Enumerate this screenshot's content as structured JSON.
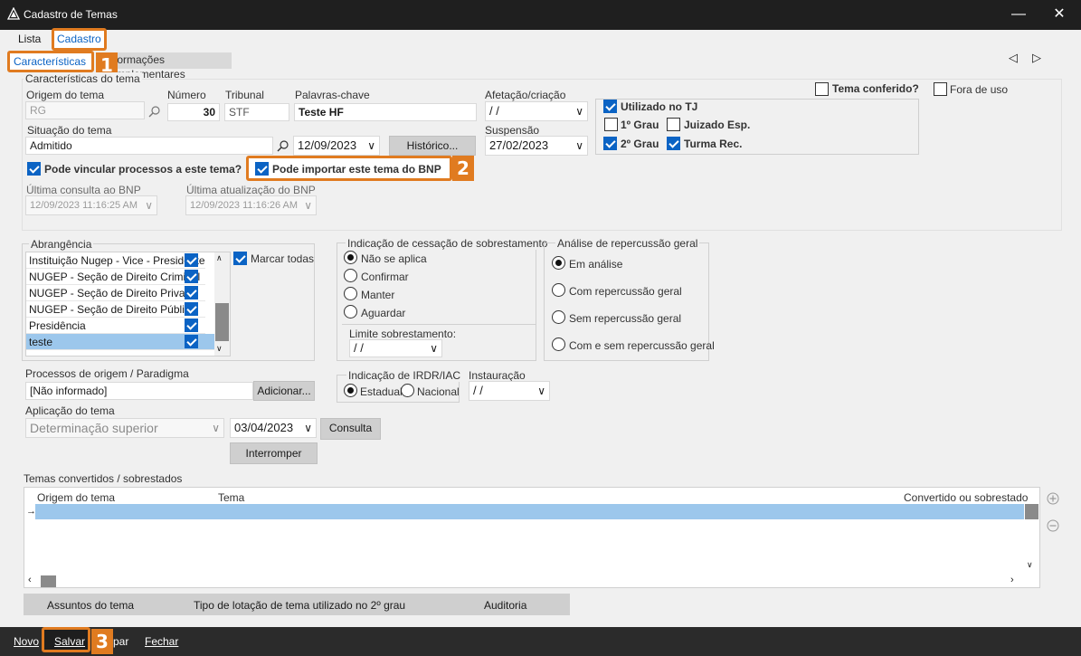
{
  "window": {
    "title": "Cadastro de Temas"
  },
  "tabs": {
    "lista": "Lista",
    "cadastro": "Cadastro"
  },
  "subtabs": {
    "caracteristicas": "Características",
    "informacoes": "Informações complementares"
  },
  "badges": {
    "b1": "1",
    "b2": "2",
    "b3": "3"
  },
  "nav": {
    "prev": "◁",
    "next": "▷"
  },
  "section": {
    "title": "Características do tema"
  },
  "fields": {
    "origem_label": "Origem do tema",
    "origem_value": "RG",
    "numero_label": "Número",
    "numero_value": "30",
    "tribunal_label": "Tribunal",
    "tribunal_value": "STF",
    "palavras_label": "Palavras-chave",
    "palavras_value": "Teste HF",
    "afetacao_label": "Afetação/criação",
    "afetacao_value": " / /",
    "situacao_label": "Situação do tema",
    "situacao_value": "Admitido",
    "situacao_date": "12/09/2023",
    "historico_btn": "Histórico...",
    "suspensao_label": "Suspensão",
    "suspensao_value": "27/02/2023",
    "ult_consulta_label": "Última consulta ao BNP",
    "ult_consulta_value": "12/09/2023 11:16:25 AM",
    "ult_atualizacao_label": "Última atualização do BNP",
    "ult_atualizacao_value": "12/09/2023 11:16:26 AM"
  },
  "checks": {
    "tema_conferido": "Tema conferido?",
    "fora_de_uso": "Fora de uso",
    "utilizado_tj": "Utilizado no TJ",
    "grau1": "1º Grau",
    "juizado": "Juizado Esp.",
    "grau2": "2º Grau",
    "turma": "Turma Rec.",
    "pode_vincular": "Pode vincular processos a este tema?",
    "pode_importar": "Pode importar este tema do BNP"
  },
  "abrangencia": {
    "title": "Abrangência",
    "marcar_todas": "Marcar todas",
    "items": [
      {
        "label": "Instituição Nugep - Vice - Presidente",
        "checked": true
      },
      {
        "label": "NUGEP - Seção de Direito Criminal",
        "checked": true
      },
      {
        "label": "NUGEP - Seção de Direito Privado",
        "checked": true
      },
      {
        "label": "NUGEP - Seção de Direito Público",
        "checked": true
      },
      {
        "label": "Presidência",
        "checked": true
      },
      {
        "label": "teste",
        "checked": true
      }
    ]
  },
  "cessacao": {
    "title": "Indicação de cessação de sobrestamento",
    "options": [
      "Não se aplica",
      "Confirmar",
      "Manter",
      "Aguardar"
    ],
    "limite_label": "Limite sobrestamento:",
    "limite_value": " / /"
  },
  "repercussao": {
    "title": "Análise de repercussão geral",
    "options": [
      "Em análise",
      "Com repercussão geral",
      "Sem repercussão geral",
      "Com e sem repercussão geral"
    ]
  },
  "processos": {
    "label": "Processos de origem / Paradigma",
    "value": "[Não informado]",
    "adicionar_btn": "Adicionar..."
  },
  "irdr": {
    "title": "Indicação de IRDR/IAC",
    "estadual": "Estadual",
    "nacional": "Nacional"
  },
  "instauracao": {
    "label": "Instauração",
    "value": " / /"
  },
  "aplicacao": {
    "label": "Aplicação do tema",
    "value": "Determinação superior",
    "date": "03/04/2023",
    "consulta_btn": "Consulta",
    "interromper_btn": "Interromper"
  },
  "temas_convertidos": {
    "label": "Temas convertidos / sobrestados",
    "columns": [
      "Origem do tema",
      "Tema",
      "Convertido ou sobrestado"
    ]
  },
  "bottom_tabs": [
    "Assuntos do tema",
    "Tipo de lotação de tema utilizado no 2º grau",
    "Auditoria"
  ],
  "footer": {
    "novo": "Novo",
    "salvar": "Salvar",
    "limpar": "par",
    "fechar": "Fechar"
  },
  "colors": {
    "accent": "#0b63c4",
    "highlight": "#e07b20",
    "selection": "#9cc7ec"
  }
}
